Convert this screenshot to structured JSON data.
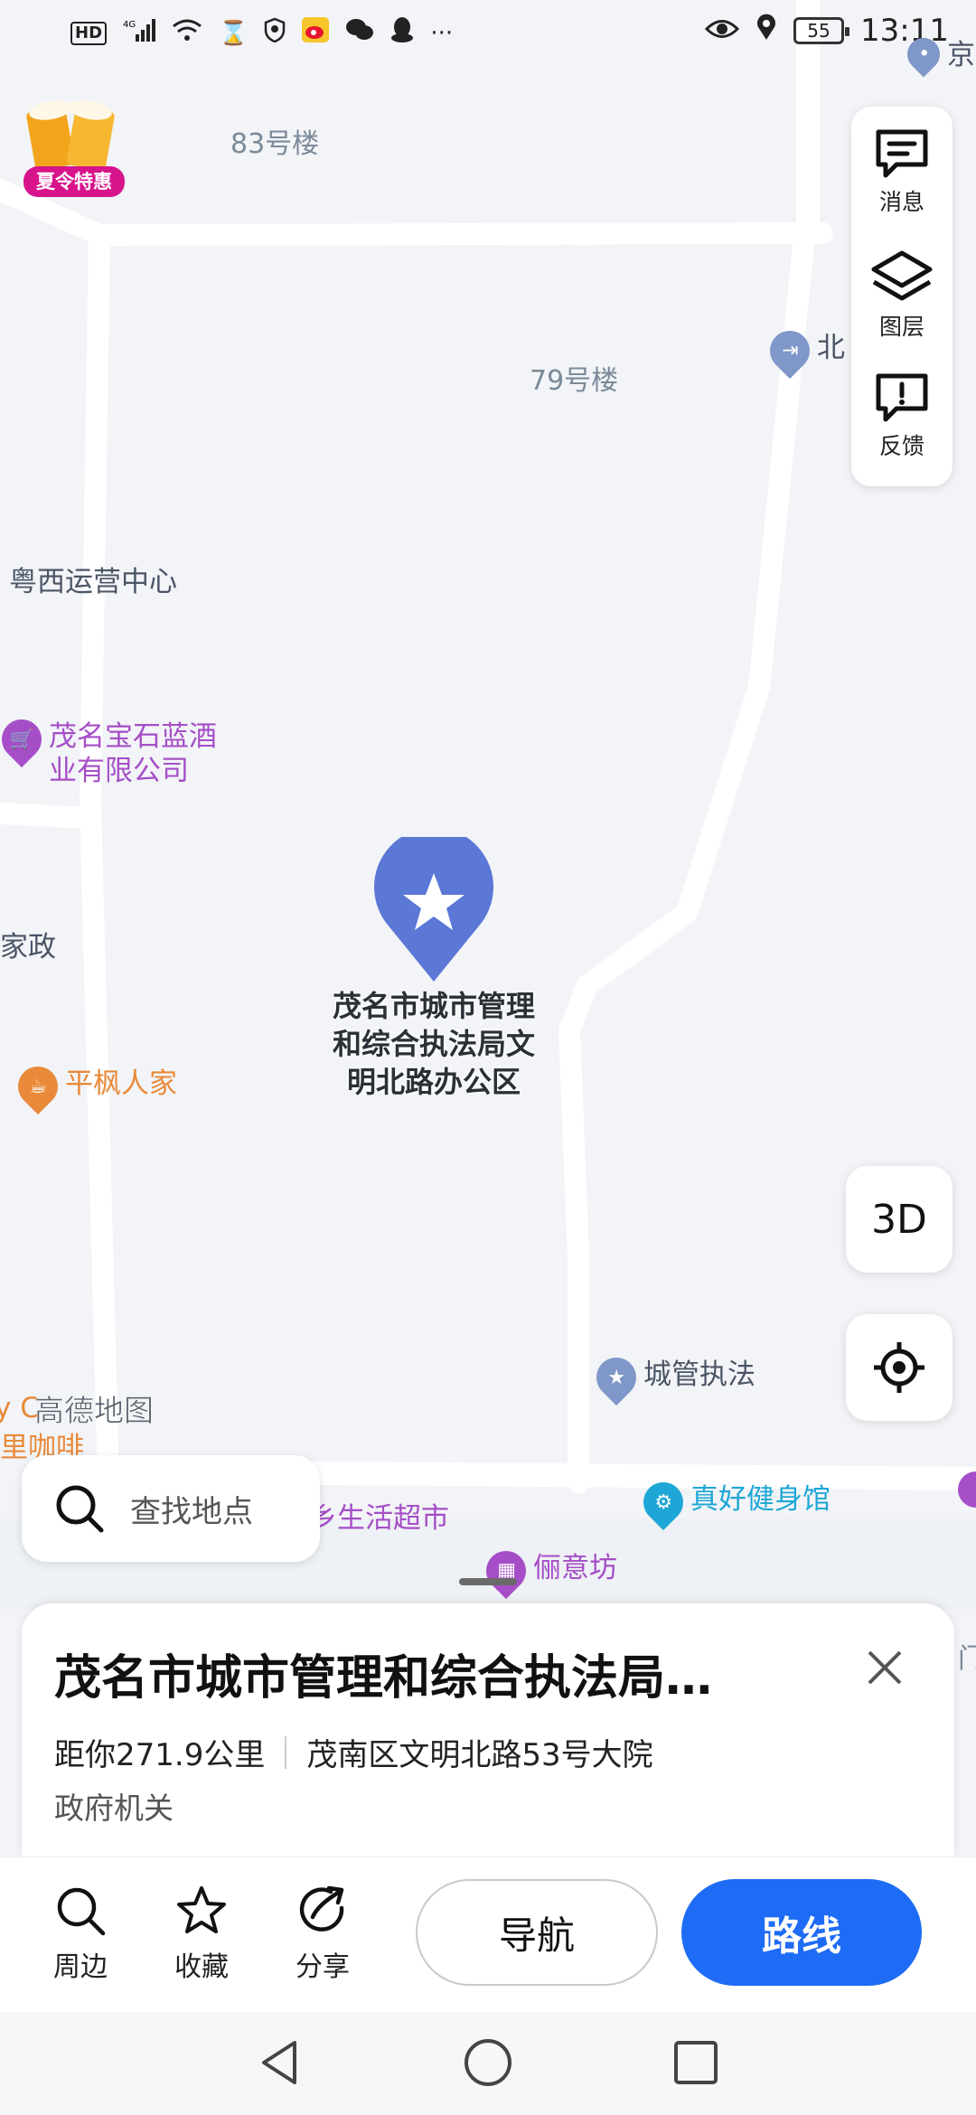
{
  "status_bar": {
    "time": "13:11",
    "battery": "55",
    "left_icons": [
      "hd-icon",
      "signal-icon",
      "wifi-icon",
      "hourglass-icon",
      "shield-icon",
      "weibo-icon",
      "wechat-icon",
      "qq-icon",
      "more-dots-icon"
    ],
    "right_icons": [
      "eye-icon",
      "location-icon",
      "battery-icon"
    ]
  },
  "promo": {
    "label": "夏令特惠"
  },
  "map": {
    "labels": {
      "bldg83": "83号楼",
      "bldg79": "79号楼",
      "yuexi": "粤西运营中心",
      "jiazheng": "家政",
      "north_partial": "北",
      "jing_partial": "京",
      "cafe_partial1": "y C",
      "cafe_partial2": "里咖啡",
      "supermarket": "乡生活超市",
      "men_partial": "门"
    },
    "pois": {
      "baoshi": "茂名宝石蓝酒\n业有限公司",
      "pingfan": "平枫人家",
      "chengguan": "城管执法",
      "gym": "真好健身馆",
      "liyi": "俪意坊"
    },
    "selected_marker_label": "茂名市城市管理\n和综合执法局文\n明北路办公区",
    "watermark": "高德地图"
  },
  "side_toolbar": {
    "messages": "消息",
    "layers": "图层",
    "feedback": "反馈"
  },
  "buttons": {
    "three_d": "3D"
  },
  "search": {
    "placeholder": "查找地点"
  },
  "detail": {
    "title": "茂名市城市管理和综合执法局…",
    "distance": "距你271.9公里",
    "address": "茂南区文明北路53号大院",
    "category": "政府机关"
  },
  "bottom_bar": {
    "nearby": "周边",
    "favorite": "收藏",
    "share": "分享",
    "navigate": "导航",
    "route": "路线"
  },
  "colors": {
    "accent_blue": "#1e6cf5",
    "marker_blue": "#5b78d6",
    "poi_purple": "#a54ec7",
    "poi_orange": "#e98a3a",
    "poi_cyan": "#1ea7d6"
  }
}
